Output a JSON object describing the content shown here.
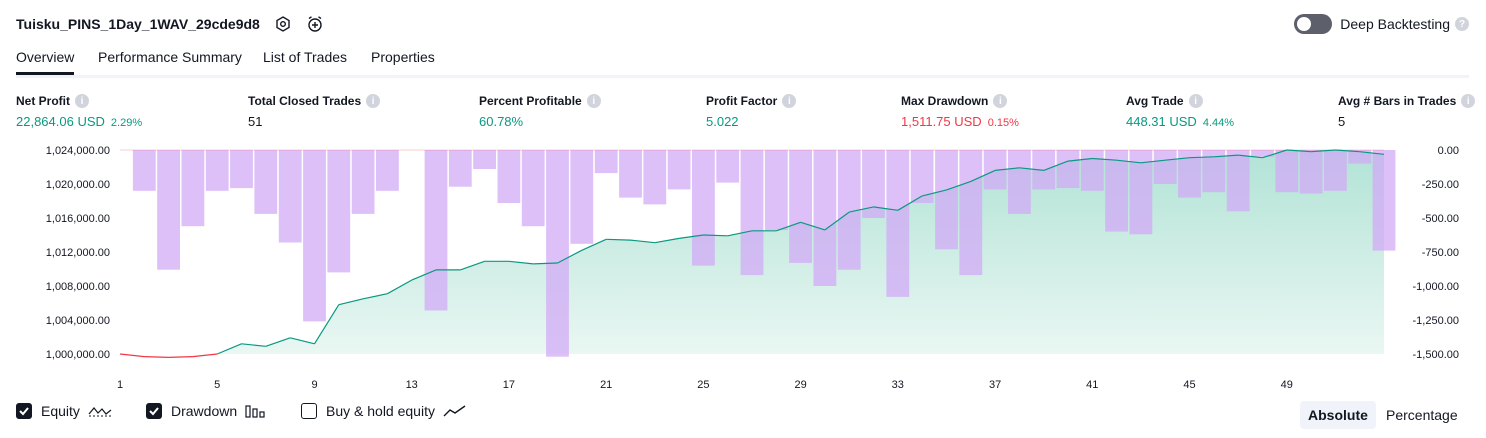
{
  "header": {
    "title": "Tuisku_PINS_1Day_1WAV_29cde9d8",
    "settings_icon": "gear-icon",
    "alert_icon": "alarm-clock-plus-icon",
    "deep_backtesting_label": "Deep Backtesting",
    "deep_backtesting_enabled": false
  },
  "tabs": [
    {
      "label": "Overview",
      "active": true
    },
    {
      "label": "Performance Summary",
      "active": false
    },
    {
      "label": "List of Trades",
      "active": false
    },
    {
      "label": "Properties",
      "active": false
    }
  ],
  "metrics": [
    {
      "label": "Net Profit",
      "value": "22,864.06 USD",
      "pct": "2.29%",
      "color": "#089981"
    },
    {
      "label": "Total Closed Trades",
      "value": "51",
      "pct": "",
      "color": "#131722"
    },
    {
      "label": "Percent Profitable",
      "value": "60.78%",
      "pct": "",
      "color": "#089981"
    },
    {
      "label": "Profit Factor",
      "value": "5.022",
      "pct": "",
      "color": "#089981"
    },
    {
      "label": "Max Drawdown",
      "value": "1,511.75 USD",
      "pct": "0.15%",
      "color": "#f23645"
    },
    {
      "label": "Avg Trade",
      "value": "448.31 USD",
      "pct": "4.44%",
      "color": "#089981"
    },
    {
      "label": "Avg # Bars in Trades",
      "value": "5",
      "pct": "",
      "color": "#131722"
    }
  ],
  "chart_data": {
    "type": "area",
    "x_ticks": [
      "1",
      "5",
      "9",
      "13",
      "17",
      "21",
      "25",
      "29",
      "33",
      "37",
      "41",
      "45",
      "49"
    ],
    "y_left_ticks": [
      "1,024,000.00",
      "1,020,000.00",
      "1,016,000.00",
      "1,012,000.00",
      "1,008,000.00",
      "1,004,000.00",
      "1,000,000.00"
    ],
    "y_right_ticks": [
      "0.00",
      "-250.00",
      "-500.00",
      "-750.00",
      "-1,000.00",
      "-1,250.00",
      "-1,500.00"
    ],
    "ylim_left": [
      1000000,
      1024000
    ],
    "ylim_right": [
      -1500,
      0
    ],
    "x_range": [
      1,
      53
    ],
    "series": [
      {
        "name": "Equity",
        "axis": "left",
        "color_positive": "#089981",
        "color_negative": "#f23645",
        "values": [
          1000000,
          999700,
          999600,
          999700,
          1000000,
          1001200,
          1000900,
          1001900,
          1001200,
          1005800,
          1006500,
          1007100,
          1008700,
          1009900,
          1009900,
          1010900,
          1010900,
          1010600,
          1010700,
          1012200,
          1013500,
          1013400,
          1013100,
          1013600,
          1014000,
          1013900,
          1014500,
          1014500,
          1015500,
          1014600,
          1016700,
          1017300,
          1016900,
          1018600,
          1019300,
          1020300,
          1021600,
          1021900,
          1021600,
          1022700,
          1023000,
          1022800,
          1022500,
          1022800,
          1023100,
          1023200,
          1023400,
          1023100,
          1024000,
          1023800,
          1024000,
          1023800,
          1023500
        ]
      },
      {
        "name": "Drawdown",
        "axis": "right",
        "color": "#d1a7f7",
        "values": [
          0,
          -300,
          -880,
          -560,
          -300,
          -280,
          -470,
          -680,
          -1260,
          -900,
          -470,
          -300,
          0,
          -1180,
          -270,
          -140,
          -390,
          -560,
          -1520,
          -690,
          -170,
          -350,
          -400,
          -290,
          -850,
          -240,
          -920,
          -590,
          -830,
          -1000,
          -880,
          -500,
          -1080,
          -390,
          -730,
          -920,
          -290,
          -470,
          -290,
          -280,
          -300,
          -600,
          -620,
          -250,
          -350,
          -310,
          -450,
          -50,
          -310,
          -320,
          -300,
          -100,
          -740
        ]
      }
    ],
    "legend": [
      {
        "label": "Equity",
        "checked": true,
        "icon": "equity-line-icon"
      },
      {
        "label": "Drawdown",
        "checked": true,
        "icon": "drawdown-bars-icon"
      },
      {
        "label": "Buy & hold equity",
        "checked": false,
        "icon": "buy-hold-line-icon"
      }
    ],
    "grid": false
  },
  "view_toggle": {
    "absolute": "Absolute",
    "percentage": "Percentage",
    "selected": "Absolute"
  }
}
